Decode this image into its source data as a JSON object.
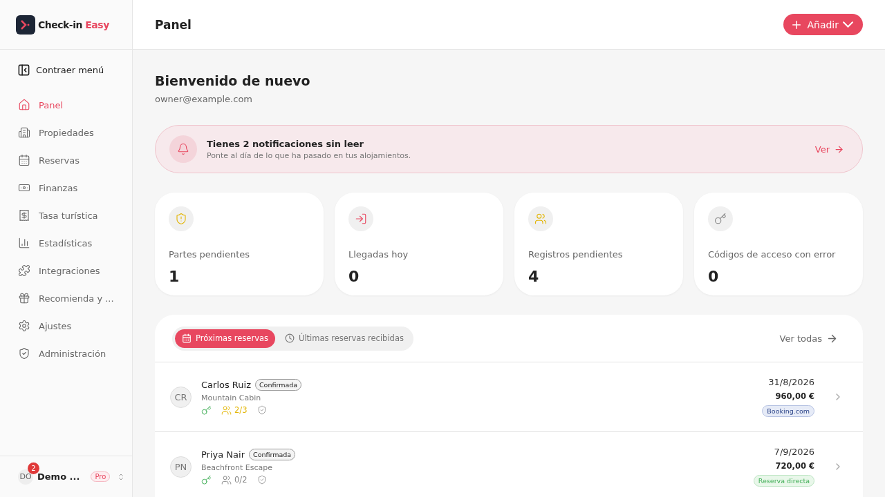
{
  "brand": {
    "name": "Check-in",
    "accent": "Easy"
  },
  "header": {
    "title": "Panel",
    "add_button": "Añadir"
  },
  "sidebar": {
    "collapse": "Contraer menú",
    "items": [
      {
        "label": "Panel",
        "selected": true
      },
      {
        "label": "Propiedades",
        "selected": false
      },
      {
        "label": "Reservas",
        "selected": false
      },
      {
        "label": "Finanzas",
        "selected": false
      },
      {
        "label": "Tasa turística",
        "selected": false
      },
      {
        "label": "Estadísticas",
        "selected": false
      },
      {
        "label": "Integraciones",
        "selected": false
      },
      {
        "label": "Recomienda y ...",
        "selected": false
      },
      {
        "label": "Ajustes",
        "selected": false
      },
      {
        "label": "Administración",
        "selected": false
      }
    ],
    "user": {
      "initials": "DO",
      "badge": "2",
      "name": "Demo ...",
      "plan": "Pro"
    }
  },
  "welcome": {
    "title": "Bienvenido de nuevo",
    "email": "owner@example.com"
  },
  "notification": {
    "title": "Tienes 2 notificaciones sin leer",
    "text": "Ponte al día de lo que ha pasado en tus alojamientos.",
    "link": "Ver"
  },
  "stats": [
    {
      "label": "Partes pendientes",
      "value": "1"
    },
    {
      "label": "Llegadas hoy",
      "value": "0"
    },
    {
      "label": "Registros pendientes",
      "value": "4"
    },
    {
      "label": "Códigos de acceso con error",
      "value": "0"
    }
  ],
  "bookings": {
    "tabs": [
      {
        "label": "Próximas reservas",
        "selected": true
      },
      {
        "label": "Últimas reservas recibidas",
        "selected": false
      }
    ],
    "view_all": "Ver todas",
    "rows": [
      {
        "initials": "CR",
        "name": "Carlos Ruiz",
        "status": "Confirmada",
        "property": "Mountain Cabin",
        "guests": "2/3",
        "guests_pending": true,
        "date": "31/8/2026",
        "amount": "960,00 €",
        "source": {
          "label": "Booking.com",
          "kind": "ota"
        }
      },
      {
        "initials": "PN",
        "name": "Priya Nair",
        "status": "Confirmada",
        "property": "Beachfront Escape",
        "guests": "0/2",
        "guests_pending": false,
        "date": "7/9/2026",
        "amount": "720,00 €",
        "source": {
          "label": "Reserva directa",
          "kind": "direct"
        }
      }
    ]
  }
}
